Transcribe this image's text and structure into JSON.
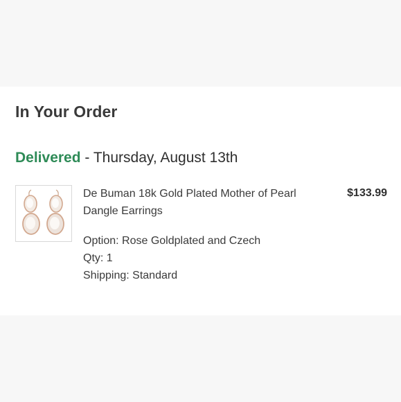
{
  "section": {
    "title": "In Your Order"
  },
  "status": {
    "word": "Delivered",
    "separator": " - ",
    "date": "Thursday, August 13th",
    "color": "#2e8b57"
  },
  "item": {
    "image_icon": "pearl-earrings-thumbnail",
    "name": "De Buman 18k Gold Plated Mother of Pearl Dangle Earrings",
    "price": "$133.99",
    "option": "Option: Rose Goldplated and Czech",
    "qty": "Qty: 1",
    "shipping": "Shipping: Standard"
  }
}
